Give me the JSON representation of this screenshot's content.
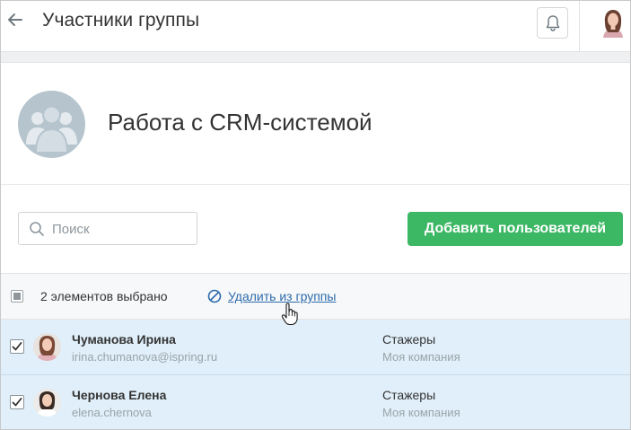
{
  "header": {
    "title": "Участники группы",
    "back_icon": "arrow-left-icon",
    "bell_icon": "bell-icon"
  },
  "group": {
    "title": "Работа с CRM-системой"
  },
  "toolbar": {
    "search_placeholder": "Поиск",
    "search_value": "",
    "add_users_label": "Добавить пользователей"
  },
  "selection": {
    "count_label": "2 элементов выбрано",
    "remove_label": "Удалить из группы"
  },
  "members": [
    {
      "name": "Чуманова Ирина",
      "email": "irina.chumanova@ispring.ru",
      "department": "Стажеры",
      "company": "Моя компания",
      "checked": true
    },
    {
      "name": "Чернова Елена",
      "email": "elena.chernova",
      "department": "Стажеры",
      "company": "Моя компания",
      "checked": true
    }
  ],
  "colors": {
    "accent_green": "#3cb764",
    "link_blue": "#2d6bab",
    "row_selected": "#e0eff9",
    "group_avatar": "#b5c4cd"
  }
}
